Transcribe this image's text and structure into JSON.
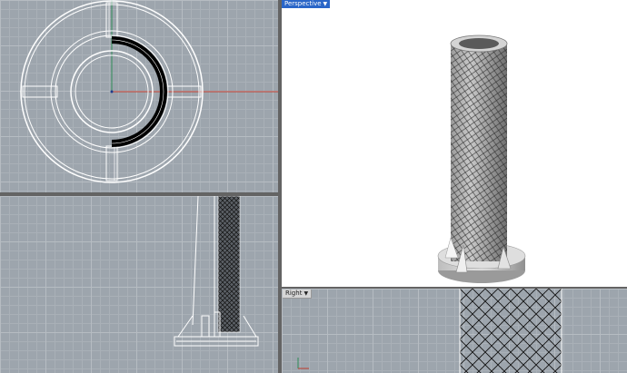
{
  "viewports": {
    "perspective": {
      "label": "Perspective"
    },
    "right": {
      "label": "Right"
    }
  },
  "icons": {
    "dropdown": "chevron-down-icon"
  },
  "colors": {
    "active_tab": "#2a66c8",
    "viewport_bg": "#9da5ad",
    "perspective_bg": "#ffffff",
    "x_axis": "#c0392b",
    "y_axis": "#2e8b57"
  }
}
